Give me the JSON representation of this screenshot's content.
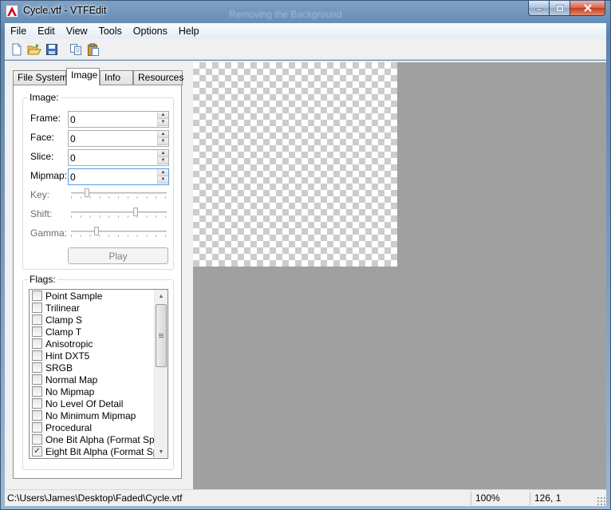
{
  "window": {
    "title": "Cycle.vtf - VTFEdit",
    "background_ghost_text": "Removing the Background"
  },
  "menu": [
    "File",
    "Edit",
    "View",
    "Tools",
    "Options",
    "Help"
  ],
  "toolbar": {
    "icons": [
      "new-icon",
      "open-icon",
      "save-icon",
      "copy-icon",
      "paste-icon"
    ]
  },
  "tabs": [
    "File System",
    "Image",
    "Info",
    "Resources"
  ],
  "active_tab": "Image",
  "image_group": {
    "label": "Image:",
    "frame_label": "Frame:",
    "frame_value": "0",
    "face_label": "Face:",
    "face_value": "0",
    "slice_label": "Slice:",
    "slice_value": "0",
    "mipmap_label": "Mipmap:",
    "mipmap_value": "0",
    "key_label": "Key:",
    "key_level": 0.15,
    "shift_label": "Shift:",
    "shift_level": 0.68,
    "gamma_label": "Gamma:",
    "gamma_level": 0.25,
    "play_label": "Play"
  },
  "flags_group": {
    "label": "Flags:",
    "items": [
      {
        "label": "Point Sample",
        "checked": false
      },
      {
        "label": "Trilinear",
        "checked": false
      },
      {
        "label": "Clamp S",
        "checked": false
      },
      {
        "label": "Clamp T",
        "checked": false
      },
      {
        "label": "Anisotropic",
        "checked": false
      },
      {
        "label": "Hint DXT5",
        "checked": false
      },
      {
        "label": "SRGB",
        "checked": false
      },
      {
        "label": "Normal Map",
        "checked": false
      },
      {
        "label": "No Mipmap",
        "checked": false
      },
      {
        "label": "No Level Of Detail",
        "checked": false
      },
      {
        "label": "No Minimum Mipmap",
        "checked": false
      },
      {
        "label": "Procedural",
        "checked": false
      },
      {
        "label": "One Bit Alpha (Format Spec",
        "checked": false
      },
      {
        "label": "Eight Bit Alpha (Format Spec",
        "checked": true
      }
    ]
  },
  "statusbar": {
    "path": "C:\\Users\\James\\Desktop\\Faded\\Cycle.vtf",
    "zoom": "100%",
    "coords": "126, 1"
  },
  "colors": {
    "viewer_background": "#a0a0a0",
    "checker_dark": "#cccccc",
    "checker_light": "#ffffff"
  }
}
